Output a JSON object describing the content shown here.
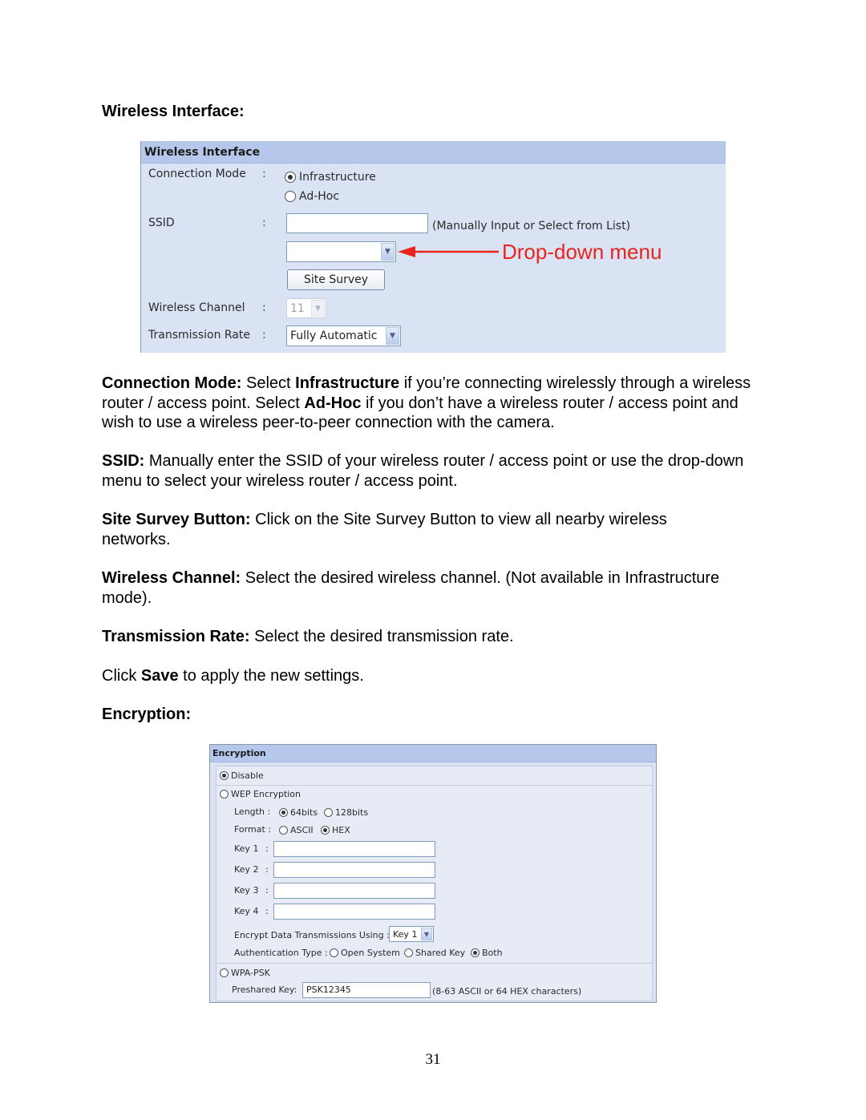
{
  "headings": {
    "wireless_interface": "Wireless Interface:",
    "encryption": "Encryption:"
  },
  "wireless_panel": {
    "title": "Wireless Interface",
    "connection_mode": {
      "label": "Connection Mode",
      "colon": ":",
      "options": [
        {
          "label": "Infrastructure",
          "selected": true
        },
        {
          "label": "Ad-Hoc",
          "selected": false
        }
      ]
    },
    "ssid": {
      "label": "SSID",
      "colon": ":",
      "value": "",
      "hint": "(Manually Input or Select from List)",
      "dropdown_value": ""
    },
    "site_survey_button": "Site Survey",
    "wireless_channel": {
      "label": "Wireless Channel",
      "colon": ":",
      "value": "11",
      "disabled": true
    },
    "transmission_rate": {
      "label": "Transmission Rate",
      "colon": ":",
      "value": "Fully Automatic"
    },
    "annotation": {
      "text": "Drop-down menu",
      "color": "#e8241c"
    },
    "dropdown_arrow_icon": "▼"
  },
  "paragraphs": {
    "connection_mode": {
      "term": "Connection Mode:",
      "t1": " Select ",
      "b1": "Infrastructure",
      "t2": " if you’re connecting wirelessly through a wireless router / access point. Select ",
      "b2": "Ad-Hoc",
      "t3": " if you don’t have a wireless router / access point and wish to use a wireless peer-to-peer connection with the camera."
    },
    "ssid": {
      "term": "SSID:",
      "text": " Manually enter the SSID of your wireless router / access point or use the drop-down menu to select your wireless router / access point."
    },
    "site_survey": {
      "term": "Site Survey Button:",
      "text": " Click on the Site Survey Button to view all nearby wireless networks."
    },
    "wireless_channel": {
      "term": "Wireless Channel:",
      "text": " Select the desired wireless channel. (Not available in Infrastructure mode)."
    },
    "transmission_rate": {
      "term": "Transmission Rate:",
      "text": " Select the desired transmission rate."
    },
    "save": {
      "t1": "Click ",
      "b1": "Save",
      "t2": " to apply the new settings."
    }
  },
  "encryption_panel": {
    "title": "Encryption",
    "disable": {
      "label": "Disable",
      "selected": true
    },
    "wep": {
      "label": "WEP Encryption",
      "selected": false,
      "length_label": "Length :",
      "length_options": [
        {
          "label": "64bits",
          "selected": true
        },
        {
          "label": "128bits",
          "selected": false
        }
      ],
      "format_label": "Format :",
      "format_options": [
        {
          "label": "ASCII",
          "selected": false
        },
        {
          "label": "HEX",
          "selected": true
        }
      ],
      "keys": [
        {
          "label": "Key 1",
          "colon": ":",
          "value": ""
        },
        {
          "label": "Key 2",
          "colon": ":",
          "value": ""
        },
        {
          "label": "Key 3",
          "colon": ":",
          "value": ""
        },
        {
          "label": "Key 4",
          "colon": ":",
          "value": ""
        }
      ],
      "encrypt_using_label": "Encrypt Data Transmissions Using :",
      "encrypt_using_value": "Key 1",
      "auth_type_label": "Authentication Type :",
      "auth_options": [
        {
          "label": "Open System",
          "selected": false
        },
        {
          "label": "Shared Key",
          "selected": false
        },
        {
          "label": "Both",
          "selected": true
        }
      ]
    },
    "wpa_psk": {
      "label": "WPA-PSK",
      "selected": false,
      "preshared_label": "Preshared Key:",
      "preshared_value": "PSK12345",
      "hint": "(8-63 ASCII or 64 HEX characters)"
    }
  },
  "page_number": "31"
}
